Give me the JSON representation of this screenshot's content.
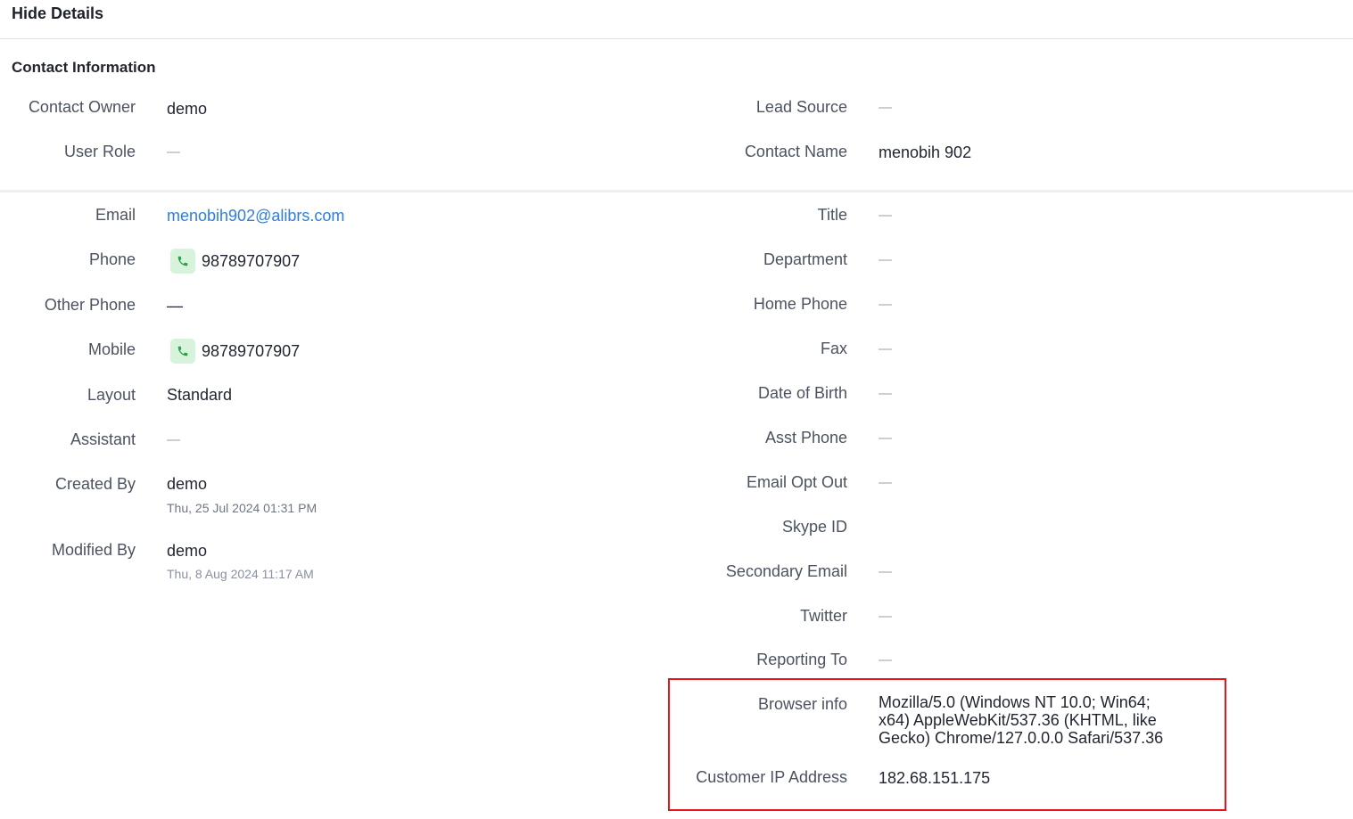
{
  "header": {
    "hide_details_label": "Hide Details"
  },
  "section": {
    "title": "Contact Information"
  },
  "top_left": {
    "contact_owner": {
      "label": "Contact Owner",
      "value": "demo"
    },
    "user_role": {
      "label": "User Role",
      "value": "—"
    }
  },
  "top_right": {
    "lead_source": {
      "label": "Lead Source",
      "value": "—"
    },
    "contact_name": {
      "label": "Contact Name",
      "value": "menobih 902"
    }
  },
  "left": {
    "email": {
      "label": "Email",
      "value": "menobih902@alibrs.com"
    },
    "phone": {
      "label": "Phone",
      "value": "98789707907"
    },
    "other_phone": {
      "label": "Other Phone",
      "value": "—"
    },
    "mobile": {
      "label": "Mobile",
      "value": "98789707907"
    },
    "layout": {
      "label": "Layout",
      "value": "Standard"
    },
    "assistant": {
      "label": "Assistant",
      "value": "—"
    },
    "created_by": {
      "label": "Created By",
      "value": "demo",
      "time": "Thu, 25 Jul 2024 01:31 PM"
    },
    "modified_by": {
      "label": "Modified By",
      "value": "demo",
      "time": "Thu, 8 Aug 2024 11:17 AM"
    }
  },
  "right": {
    "title": {
      "label": "Title",
      "value": "—"
    },
    "department": {
      "label": "Department",
      "value": "—"
    },
    "home_phone": {
      "label": "Home Phone",
      "value": "—"
    },
    "fax": {
      "label": "Fax",
      "value": "—"
    },
    "date_of_birth": {
      "label": "Date of Birth",
      "value": "—"
    },
    "asst_phone": {
      "label": "Asst Phone",
      "value": "—"
    },
    "email_opt_out": {
      "label": "Email Opt Out",
      "value": "—"
    },
    "skype_id": {
      "label": "Skype ID",
      "value": ""
    },
    "secondary_email": {
      "label": "Secondary Email",
      "value": "—"
    },
    "twitter": {
      "label": "Twitter",
      "value": "—"
    },
    "reporting_to": {
      "label": "Reporting To",
      "value": "—"
    },
    "browser_info": {
      "label": "Browser info",
      "value": "Mozilla/5.0 (Windows NT 10.0; Win64; x64) AppleWebKit/537.36 (KHTML, like Gecko) Chrome/127.0.0.0 Safari/537.36"
    },
    "customer_ip": {
      "label": "Customer IP Address",
      "value": "182.68.151.175"
    }
  },
  "icons": {
    "phone": "phone-icon"
  },
  "colors": {
    "link": "#2f7de1",
    "highlight": "#e8131c",
    "phone_icon_bg": "#d7f3dc",
    "phone_icon_fg": "#2e9e47"
  }
}
